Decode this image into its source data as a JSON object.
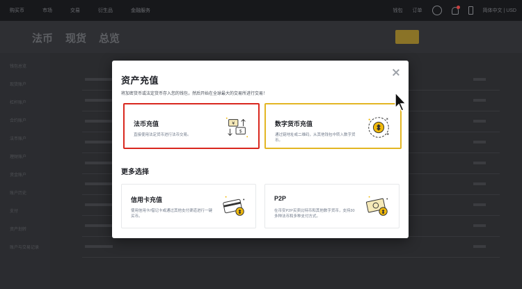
{
  "topbar": {
    "nav": [
      "购买币",
      "市场",
      "交易",
      "衍生品",
      "金融服务"
    ],
    "right": [
      "钱包",
      "订单",
      "简体中文 | USD"
    ]
  },
  "subheader": {
    "tabs": [
      "法币",
      "现货",
      "总览"
    ]
  },
  "sidebar": {
    "items": [
      "钱包总览",
      "现货账户",
      "杠杆账户",
      "合约账户",
      "法币账户",
      "理财账户",
      "资金账户",
      "账户历史",
      "支付",
      "资产划转",
      "账户与交易记录"
    ]
  },
  "modal": {
    "title": "资产充值",
    "subtitle": "将加密货币或法定货币存入您的钱包，然后开始在全球最大的交易所进行交易！",
    "cards": {
      "fiat": {
        "title": "法币充值",
        "desc": "直接使用法定货币进行法币交易。",
        "icon": "fiat-exchange-icon"
      },
      "crypto": {
        "title": "数字货币充值",
        "desc": "通过链地址或二维码，从其他钱包中转入数字货币。",
        "icon": "crypto-coin-icon"
      }
    },
    "section_title": "更多选择",
    "more": {
      "credit": {
        "title": "信用卡充值",
        "desc": "使用信用卡/借记卡或通过其他支付渠道进行一键买币。",
        "icon": "card-payment-icon"
      },
      "p2p": {
        "title": "P2P",
        "desc": "在币安P2P买卖比特币和其他数字货币，支持30多种法币和多种支付方式。",
        "icon": "p2p-cash-icon"
      }
    }
  },
  "colors": {
    "fiat_highlight": "#d9271e",
    "crypto_highlight": "#e3b623",
    "accent": "#f0b90b"
  }
}
